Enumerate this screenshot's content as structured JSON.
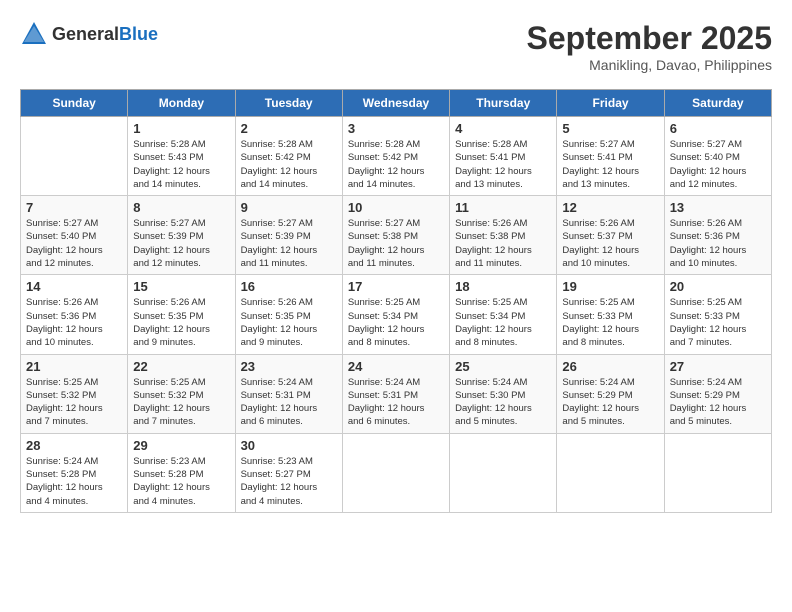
{
  "logo": {
    "text_general": "General",
    "text_blue": "Blue"
  },
  "title": {
    "month_year": "September 2025",
    "location": "Manikling, Davao, Philippines"
  },
  "days_of_week": [
    "Sunday",
    "Monday",
    "Tuesday",
    "Wednesday",
    "Thursday",
    "Friday",
    "Saturday"
  ],
  "weeks": [
    [
      {
        "day": "",
        "info": ""
      },
      {
        "day": "1",
        "info": "Sunrise: 5:28 AM\nSunset: 5:43 PM\nDaylight: 12 hours\nand 14 minutes."
      },
      {
        "day": "2",
        "info": "Sunrise: 5:28 AM\nSunset: 5:42 PM\nDaylight: 12 hours\nand 14 minutes."
      },
      {
        "day": "3",
        "info": "Sunrise: 5:28 AM\nSunset: 5:42 PM\nDaylight: 12 hours\nand 14 minutes."
      },
      {
        "day": "4",
        "info": "Sunrise: 5:28 AM\nSunset: 5:41 PM\nDaylight: 12 hours\nand 13 minutes."
      },
      {
        "day": "5",
        "info": "Sunrise: 5:27 AM\nSunset: 5:41 PM\nDaylight: 12 hours\nand 13 minutes."
      },
      {
        "day": "6",
        "info": "Sunrise: 5:27 AM\nSunset: 5:40 PM\nDaylight: 12 hours\nand 12 minutes."
      }
    ],
    [
      {
        "day": "7",
        "info": "Sunrise: 5:27 AM\nSunset: 5:40 PM\nDaylight: 12 hours\nand 12 minutes."
      },
      {
        "day": "8",
        "info": "Sunrise: 5:27 AM\nSunset: 5:39 PM\nDaylight: 12 hours\nand 12 minutes."
      },
      {
        "day": "9",
        "info": "Sunrise: 5:27 AM\nSunset: 5:39 PM\nDaylight: 12 hours\nand 11 minutes."
      },
      {
        "day": "10",
        "info": "Sunrise: 5:27 AM\nSunset: 5:38 PM\nDaylight: 12 hours\nand 11 minutes."
      },
      {
        "day": "11",
        "info": "Sunrise: 5:26 AM\nSunset: 5:38 PM\nDaylight: 12 hours\nand 11 minutes."
      },
      {
        "day": "12",
        "info": "Sunrise: 5:26 AM\nSunset: 5:37 PM\nDaylight: 12 hours\nand 10 minutes."
      },
      {
        "day": "13",
        "info": "Sunrise: 5:26 AM\nSunset: 5:36 PM\nDaylight: 12 hours\nand 10 minutes."
      }
    ],
    [
      {
        "day": "14",
        "info": "Sunrise: 5:26 AM\nSunset: 5:36 PM\nDaylight: 12 hours\nand 10 minutes."
      },
      {
        "day": "15",
        "info": "Sunrise: 5:26 AM\nSunset: 5:35 PM\nDaylight: 12 hours\nand 9 minutes."
      },
      {
        "day": "16",
        "info": "Sunrise: 5:26 AM\nSunset: 5:35 PM\nDaylight: 12 hours\nand 9 minutes."
      },
      {
        "day": "17",
        "info": "Sunrise: 5:25 AM\nSunset: 5:34 PM\nDaylight: 12 hours\nand 8 minutes."
      },
      {
        "day": "18",
        "info": "Sunrise: 5:25 AM\nSunset: 5:34 PM\nDaylight: 12 hours\nand 8 minutes."
      },
      {
        "day": "19",
        "info": "Sunrise: 5:25 AM\nSunset: 5:33 PM\nDaylight: 12 hours\nand 8 minutes."
      },
      {
        "day": "20",
        "info": "Sunrise: 5:25 AM\nSunset: 5:33 PM\nDaylight: 12 hours\nand 7 minutes."
      }
    ],
    [
      {
        "day": "21",
        "info": "Sunrise: 5:25 AM\nSunset: 5:32 PM\nDaylight: 12 hours\nand 7 minutes."
      },
      {
        "day": "22",
        "info": "Sunrise: 5:25 AM\nSunset: 5:32 PM\nDaylight: 12 hours\nand 7 minutes."
      },
      {
        "day": "23",
        "info": "Sunrise: 5:24 AM\nSunset: 5:31 PM\nDaylight: 12 hours\nand 6 minutes."
      },
      {
        "day": "24",
        "info": "Sunrise: 5:24 AM\nSunset: 5:31 PM\nDaylight: 12 hours\nand 6 minutes."
      },
      {
        "day": "25",
        "info": "Sunrise: 5:24 AM\nSunset: 5:30 PM\nDaylight: 12 hours\nand 5 minutes."
      },
      {
        "day": "26",
        "info": "Sunrise: 5:24 AM\nSunset: 5:29 PM\nDaylight: 12 hours\nand 5 minutes."
      },
      {
        "day": "27",
        "info": "Sunrise: 5:24 AM\nSunset: 5:29 PM\nDaylight: 12 hours\nand 5 minutes."
      }
    ],
    [
      {
        "day": "28",
        "info": "Sunrise: 5:24 AM\nSunset: 5:28 PM\nDaylight: 12 hours\nand 4 minutes."
      },
      {
        "day": "29",
        "info": "Sunrise: 5:23 AM\nSunset: 5:28 PM\nDaylight: 12 hours\nand 4 minutes."
      },
      {
        "day": "30",
        "info": "Sunrise: 5:23 AM\nSunset: 5:27 PM\nDaylight: 12 hours\nand 4 minutes."
      },
      {
        "day": "",
        "info": ""
      },
      {
        "day": "",
        "info": ""
      },
      {
        "day": "",
        "info": ""
      },
      {
        "day": "",
        "info": ""
      }
    ]
  ]
}
